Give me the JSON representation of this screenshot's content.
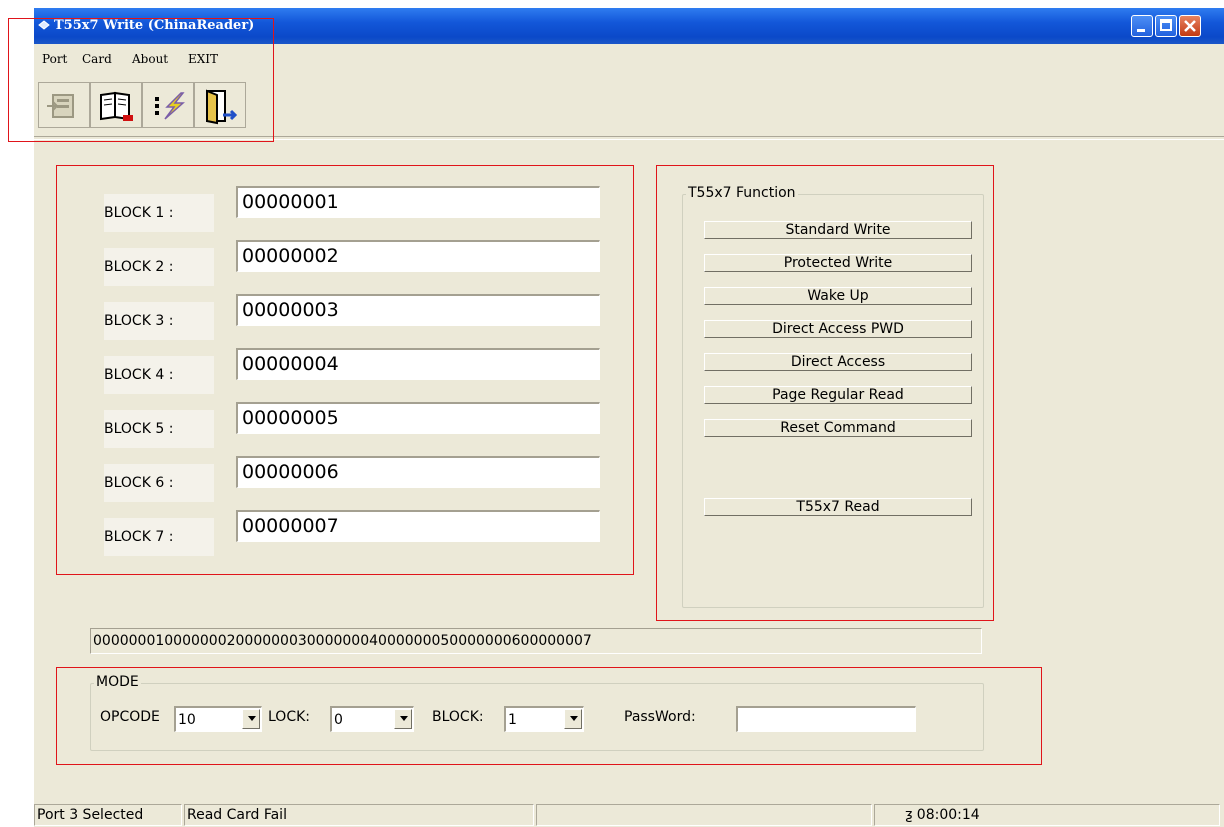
{
  "window": {
    "title": "T55x7 Write (ChinaReader)",
    "title_icon": "card-reader-icon",
    "controls": [
      "minimize-icon",
      "maximize-icon",
      "close-icon"
    ]
  },
  "menu": {
    "items": [
      "Port",
      "Card",
      "About",
      "EXIT"
    ]
  },
  "toolbar": {
    "buttons": [
      "port-icon",
      "read-card-icon",
      "write-card-icon",
      "exit-door-icon"
    ]
  },
  "blocks": [
    {
      "label": "BLOCK 1 :",
      "value": "00000001"
    },
    {
      "label": "BLOCK 2 :",
      "value": "00000002"
    },
    {
      "label": "BLOCK 3 :",
      "value": "00000003"
    },
    {
      "label": "BLOCK 4 :",
      "value": "00000004"
    },
    {
      "label": "BLOCK 5 :",
      "value": "00000005"
    },
    {
      "label": "BLOCK 6 :",
      "value": "00000006"
    },
    {
      "label": "BLOCK 7 :",
      "value": "00000007"
    }
  ],
  "functions": {
    "title": "T55x7 Function",
    "buttons": [
      "Standard  Write",
      "Protected  Write",
      "Wake  Up",
      "Direct  Access  PWD",
      "Direct  Access",
      "Page  Regular  Read",
      "Reset  Command"
    ],
    "read_button": "T55x7  Read"
  },
  "concat_value": "00000001000000020000000300000004000000050000000600000007",
  "mode": {
    "title": "MODE",
    "opcode_label": "OPCODE",
    "opcode_value": "10",
    "lock_label": "LOCK:",
    "lock_value": "0",
    "block_label": "BLOCK:",
    "block_value": "1",
    "password_label": "PassWord:",
    "password_value": ""
  },
  "status": {
    "port": "Port 3 Selected",
    "card": "Read Card Fail",
    "empty": "",
    "time": "ƺ 08:00:14"
  },
  "colors": {
    "highlight": "#e0141a",
    "title_bar": "#0b49c9",
    "window_bg": "#ece9d8"
  }
}
